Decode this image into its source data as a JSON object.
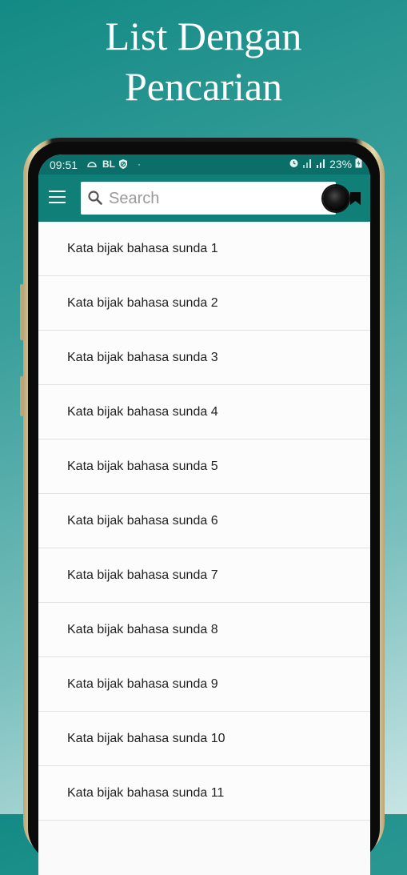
{
  "promo": {
    "title_line1": "List Dengan",
    "title_line2": "Pencarian"
  },
  "status_bar": {
    "time": "09:51",
    "left_icons": [
      "cloud-icon",
      "bl-badge",
      "shield-icon",
      "dot"
    ],
    "bl_label": "BL",
    "dot": "·",
    "battery": "23%",
    "right_icons": [
      "alarm-icon",
      "signal-icon",
      "signal-icon",
      "battery-charging-icon"
    ]
  },
  "app_bar": {
    "menu_icon": "hamburger-menu-icon",
    "search": {
      "placeholder": "Search",
      "value": ""
    },
    "bookmark_icon": "bookmark-icon"
  },
  "list": {
    "items": [
      {
        "label": "Kata bijak bahasa sunda 1"
      },
      {
        "label": "Kata bijak bahasa sunda 2"
      },
      {
        "label": "Kata bijak bahasa sunda 3"
      },
      {
        "label": "Kata bijak bahasa sunda 4"
      },
      {
        "label": "Kata bijak bahasa sunda 5"
      },
      {
        "label": "Kata bijak bahasa sunda 6"
      },
      {
        "label": "Kata bijak bahasa sunda 7"
      },
      {
        "label": "Kata bijak bahasa sunda 8"
      },
      {
        "label": "Kata bijak bahasa sunda 9"
      },
      {
        "label": "Kata bijak bahasa sunda 10"
      },
      {
        "label": "Kata bijak bahasa sunda 11"
      }
    ]
  },
  "colors": {
    "primary": "#0f7f78",
    "status_bar": "#0c6e68",
    "background_gradient_start": "#138a85",
    "background_gradient_end": "#c7e4e4"
  }
}
